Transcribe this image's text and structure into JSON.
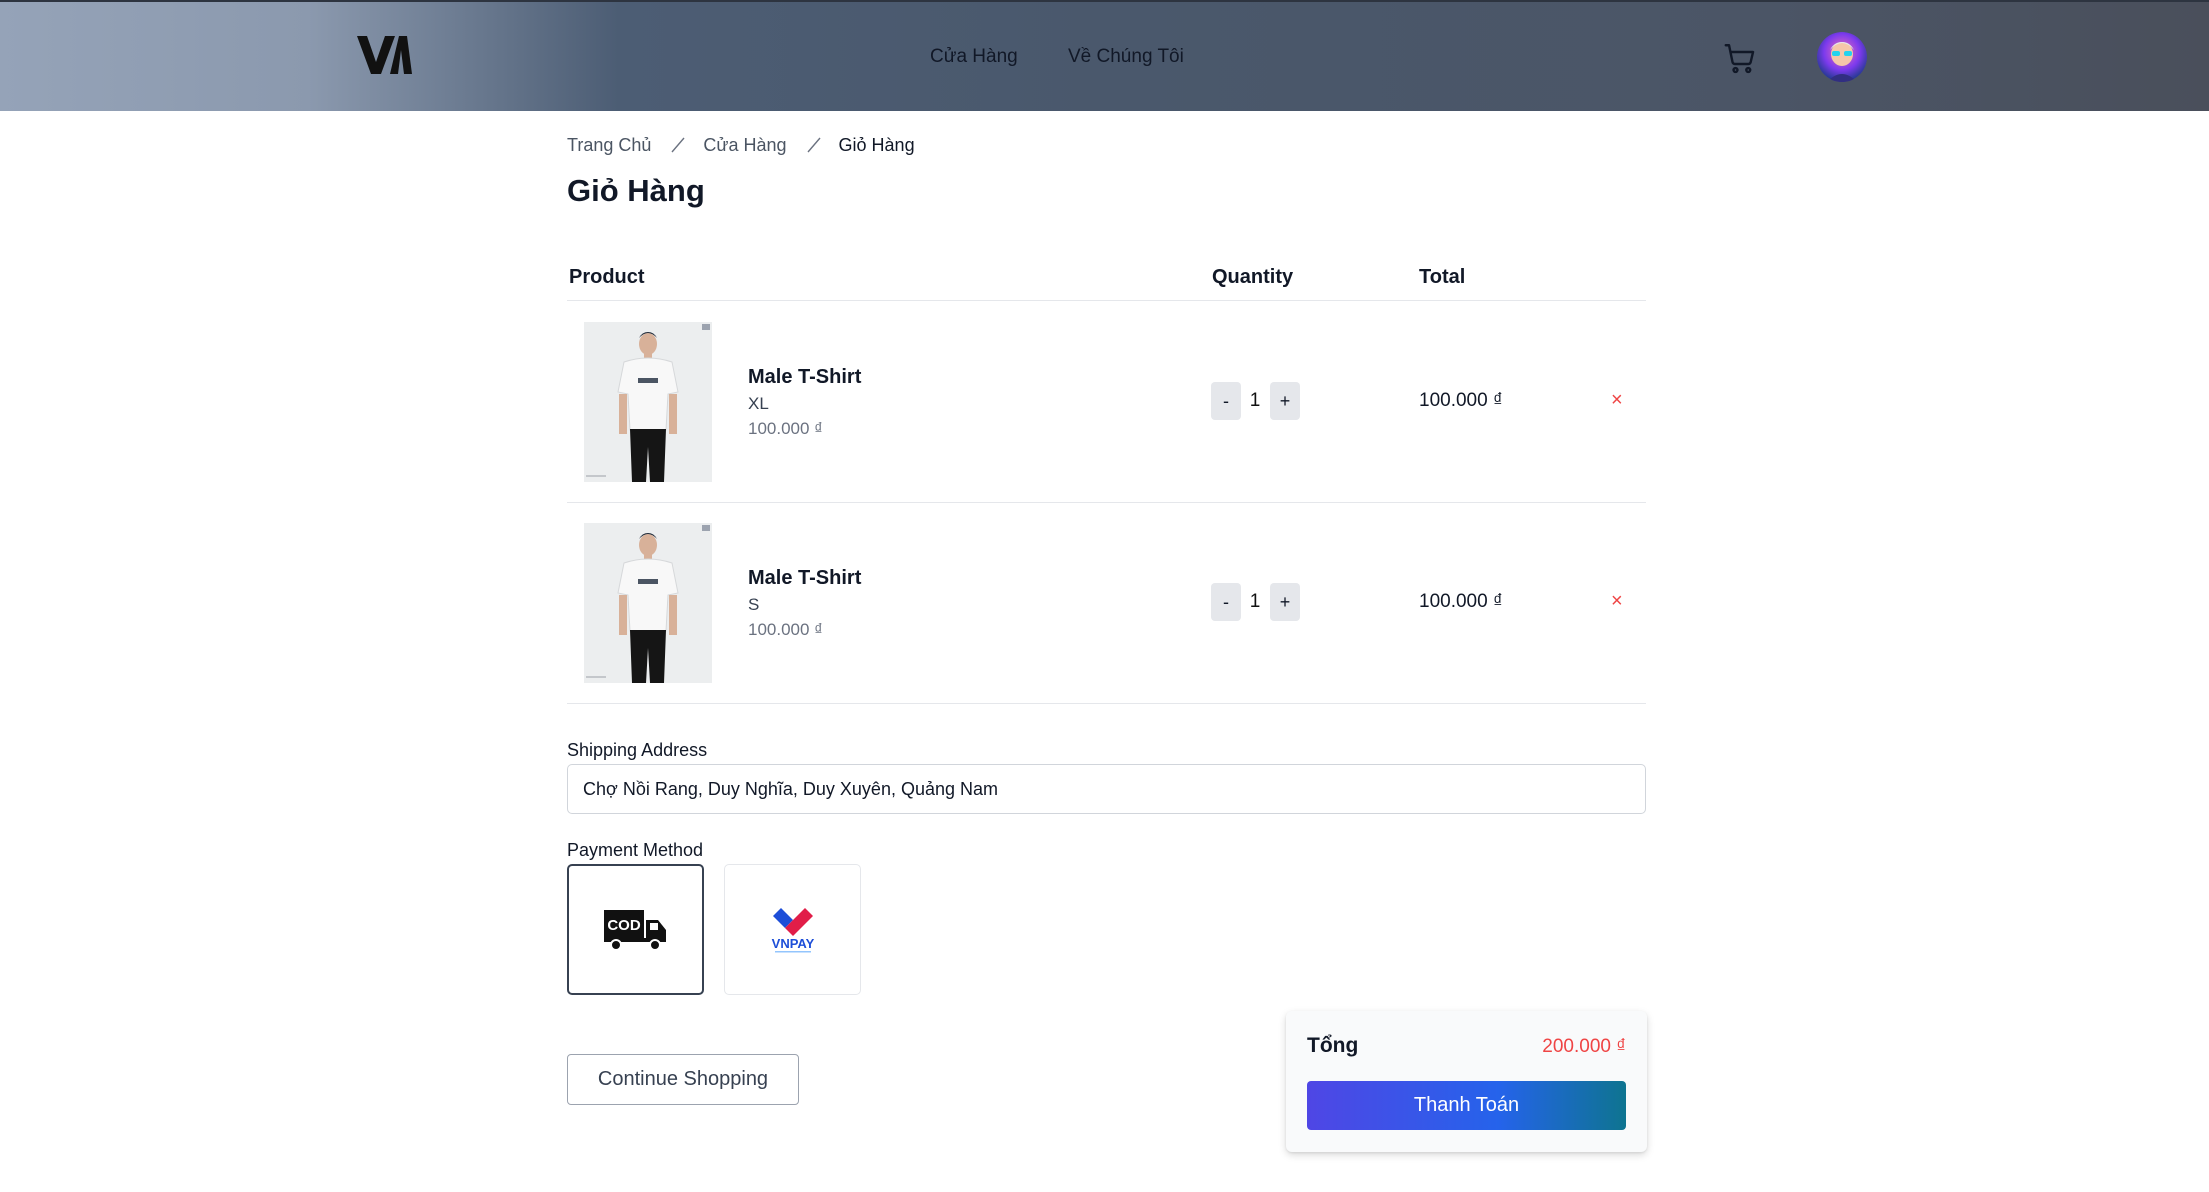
{
  "header": {
    "logo_text": "VA",
    "nav": [
      {
        "label": "Cửa Hàng"
      },
      {
        "label": "Về Chúng Tôi"
      }
    ]
  },
  "breadcrumb": {
    "items": [
      "Trang Chủ",
      "Cửa Hàng"
    ],
    "current": "Giỏ Hàng"
  },
  "page": {
    "title": "Giỏ Hàng"
  },
  "table": {
    "headers": {
      "product": "Product",
      "quantity": "Quantity",
      "total": "Total"
    },
    "rows": [
      {
        "name": "Male T-Shirt",
        "size": "XL",
        "price": "100.000 ₫",
        "quantity": "1",
        "minus": "-",
        "plus": "+",
        "total": "100.000 ₫",
        "remove": "×"
      },
      {
        "name": "Male T-Shirt",
        "size": "S",
        "price": "100.000 ₫",
        "quantity": "1",
        "minus": "-",
        "plus": "+",
        "total": "100.000 ₫",
        "remove": "×"
      }
    ]
  },
  "shipping": {
    "label": "Shipping Address",
    "value": "Chợ Nồi Rang, Duy Nghĩa, Duy Xuyên, Quảng Nam"
  },
  "payment": {
    "label": "Payment Method",
    "options": [
      {
        "id": "cod",
        "logo_text": "COD",
        "selected": true
      },
      {
        "id": "vnpay",
        "logo_text": "VNPAY",
        "selected": false
      }
    ]
  },
  "actions": {
    "continue_label": "Continue Shopping"
  },
  "summary": {
    "label": "Tổng",
    "value": "200.000 ₫",
    "checkout_label": "Thanh Toán"
  },
  "colors": {
    "accent_red": "#ef4444",
    "button_gradient_start": "#4f46e5",
    "button_gradient_end": "#0e7490"
  }
}
